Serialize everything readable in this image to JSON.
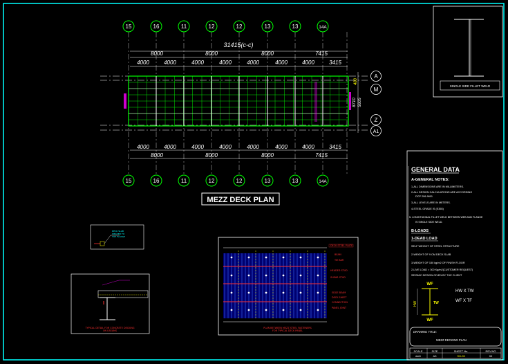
{
  "plan": {
    "grid_labels_top": [
      "15",
      "16",
      "11",
      "12",
      "12",
      "13",
      "13",
      "14A"
    ],
    "grid_labels_bottom": [
      "15",
      "16",
      "11",
      "12",
      "12",
      "13",
      "13",
      "14A"
    ],
    "overall_dim": "31415(c-c)",
    "top_dims_row1": [
      "8000",
      "8000",
      "8000",
      "7415"
    ],
    "top_dims_row2": [
      "4000",
      "4000",
      "4000",
      "4000",
      "4000",
      "4000",
      "4000",
      "3415"
    ],
    "bottom_dims_row1": [
      "4000",
      "4000",
      "4000",
      "4000",
      "4000",
      "4000",
      "4000",
      "3415"
    ],
    "bottom_dims_row2": [
      "8000",
      "8000",
      "8000",
      "7415"
    ],
    "right_labels": [
      "A",
      "M",
      "Z",
      "A1"
    ],
    "right_dims": [
      "480",
      "8710",
      "5605"
    ],
    "title": "MEZZ DECK PLAN"
  },
  "beam_detail": {
    "caption": "SINGLE SIDE FILLET WELD"
  },
  "general_data": {
    "heading": "GENERAL DATA",
    "lines": [
      "A-GENERAL NOTES:",
      "1-ALL DIMENSIONS ARE IN MILLIMETERS.",
      "2-ALL DESIGN CALCULATIONS ARE ACCORDING",
      "DCP 206-9601",
      "3-ALL LEVELS ARE IN METERS.",
      "4-STEEL GRADE IS (S355)",
      "5- LONGITUDINAL FILLET WELD BETWEEN WEB AND FLANGE",
      "IS SINGLE SIDE WELD.",
      "B-LOADS",
      "1-DEAD LOAD",
      "SELF WEIGHT OF STEEL STRUCTURE",
      "2-WEIGHT OF 9 CM DECK SLAB",
      "3-WEIGHT OF 150 kg/m2 OF FINISH FLOOR",
      "2-LIVE LOAD = 300 Kg/m2(CUSTOMER REQUEST)",
      "SEISMIC DESIGN GIVEN BY THE CLIENT"
    ],
    "section_labels": {
      "wf_top": "WF",
      "hw": "HW",
      "tw": "TW",
      "wf_bottom": "WF",
      "hw_tw": "HW X TW",
      "wf_tf": "WF X TF"
    },
    "drawing_title_label": "DRAWING TITLE:",
    "drawing_title": "MEZZ DECKING PLAN",
    "footer_headers": [
      "SCALE",
      "SIZE",
      "SHEET No.",
      "REV.NO"
    ],
    "footer_values": [
      "##/#",
      "A3",
      "SH-05",
      "00"
    ]
  },
  "small_detail": {
    "lines": [
      "DECK SLAB",
      "WELDED TO",
      "TOP FLANGE"
    ]
  },
  "typical_detail": {
    "caption1": "TYPICAL DETAIL FOR CONCRETE DECKING",
    "caption2": "ON I-BEAMS"
  },
  "connection_detail": {
    "caption1": "PLAN BETWEEN MEZZ STEEL FASTENERS",
    "caption2": "FOR TYPICAL DECK PANEL",
    "labels": [
      "DECK STEEL PLATE",
      "BEAM",
      "TIE BAR",
      "HEADED STUD",
      "SHEAR STUD",
      "EDGE BEAM",
      "DECK SHEET",
      "CONNECTION",
      "PANEL JOINT"
    ]
  },
  "colors": {
    "frame": "#00ffff",
    "grid": "#00ff00",
    "text": "#ffffff",
    "accent_magenta": "#ff00ff",
    "accent_blue": "#0000ff",
    "accent_yellow": "#ffff00",
    "accent_red": "#ff0000"
  }
}
